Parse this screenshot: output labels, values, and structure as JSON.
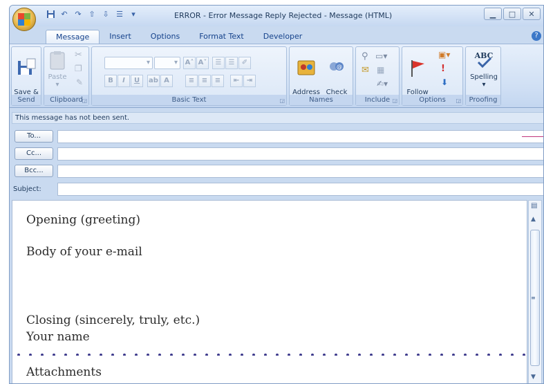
{
  "window": {
    "title": "ERROR - Error Message Reply Rejected - Message (HTML)"
  },
  "quick_access": {
    "icons": [
      "save-icon",
      "undo-icon",
      "redo-icon",
      "previous-icon",
      "next-icon",
      "format-icon",
      "customize-icon"
    ]
  },
  "tabs": [
    "Message",
    "Insert",
    "Options",
    "Format Text",
    "Developer"
  ],
  "ribbon": {
    "send": {
      "button": "Save &\nClose",
      "label": "Send"
    },
    "clipboard": {
      "paste": "Paste",
      "label": "Clipboard"
    },
    "basic_text": {
      "label": "Basic Text"
    },
    "names": {
      "address_book": "Address\nBook",
      "check_names": "Check\nNames",
      "label": "Names"
    },
    "include": {
      "label": "Include"
    },
    "options": {
      "follow_up": "Follow\nUp",
      "label": "Options"
    },
    "proofing": {
      "spelling": "Spelling",
      "abc": "ABC",
      "label": "Proofing"
    }
  },
  "info_bar": "This message has not been sent.",
  "address": {
    "to_label": "To...",
    "cc_label": "Cc...",
    "bcc_label": "Bcc...",
    "subject_label": "Subject:",
    "to_value": "",
    "cc_value": "",
    "bcc_value": ""
  },
  "body": {
    "opening": "Opening (greeting)",
    "body": "Body of your e-mail",
    "closing": "Closing (sincerely, truly, etc.)",
    "name": "Your name",
    "attachments": "Attachments"
  },
  "colors": {
    "accent": "#15428b",
    "ribbon": "#cfdff4",
    "dots": "#3d3a8c",
    "marker": "#c0357a"
  }
}
